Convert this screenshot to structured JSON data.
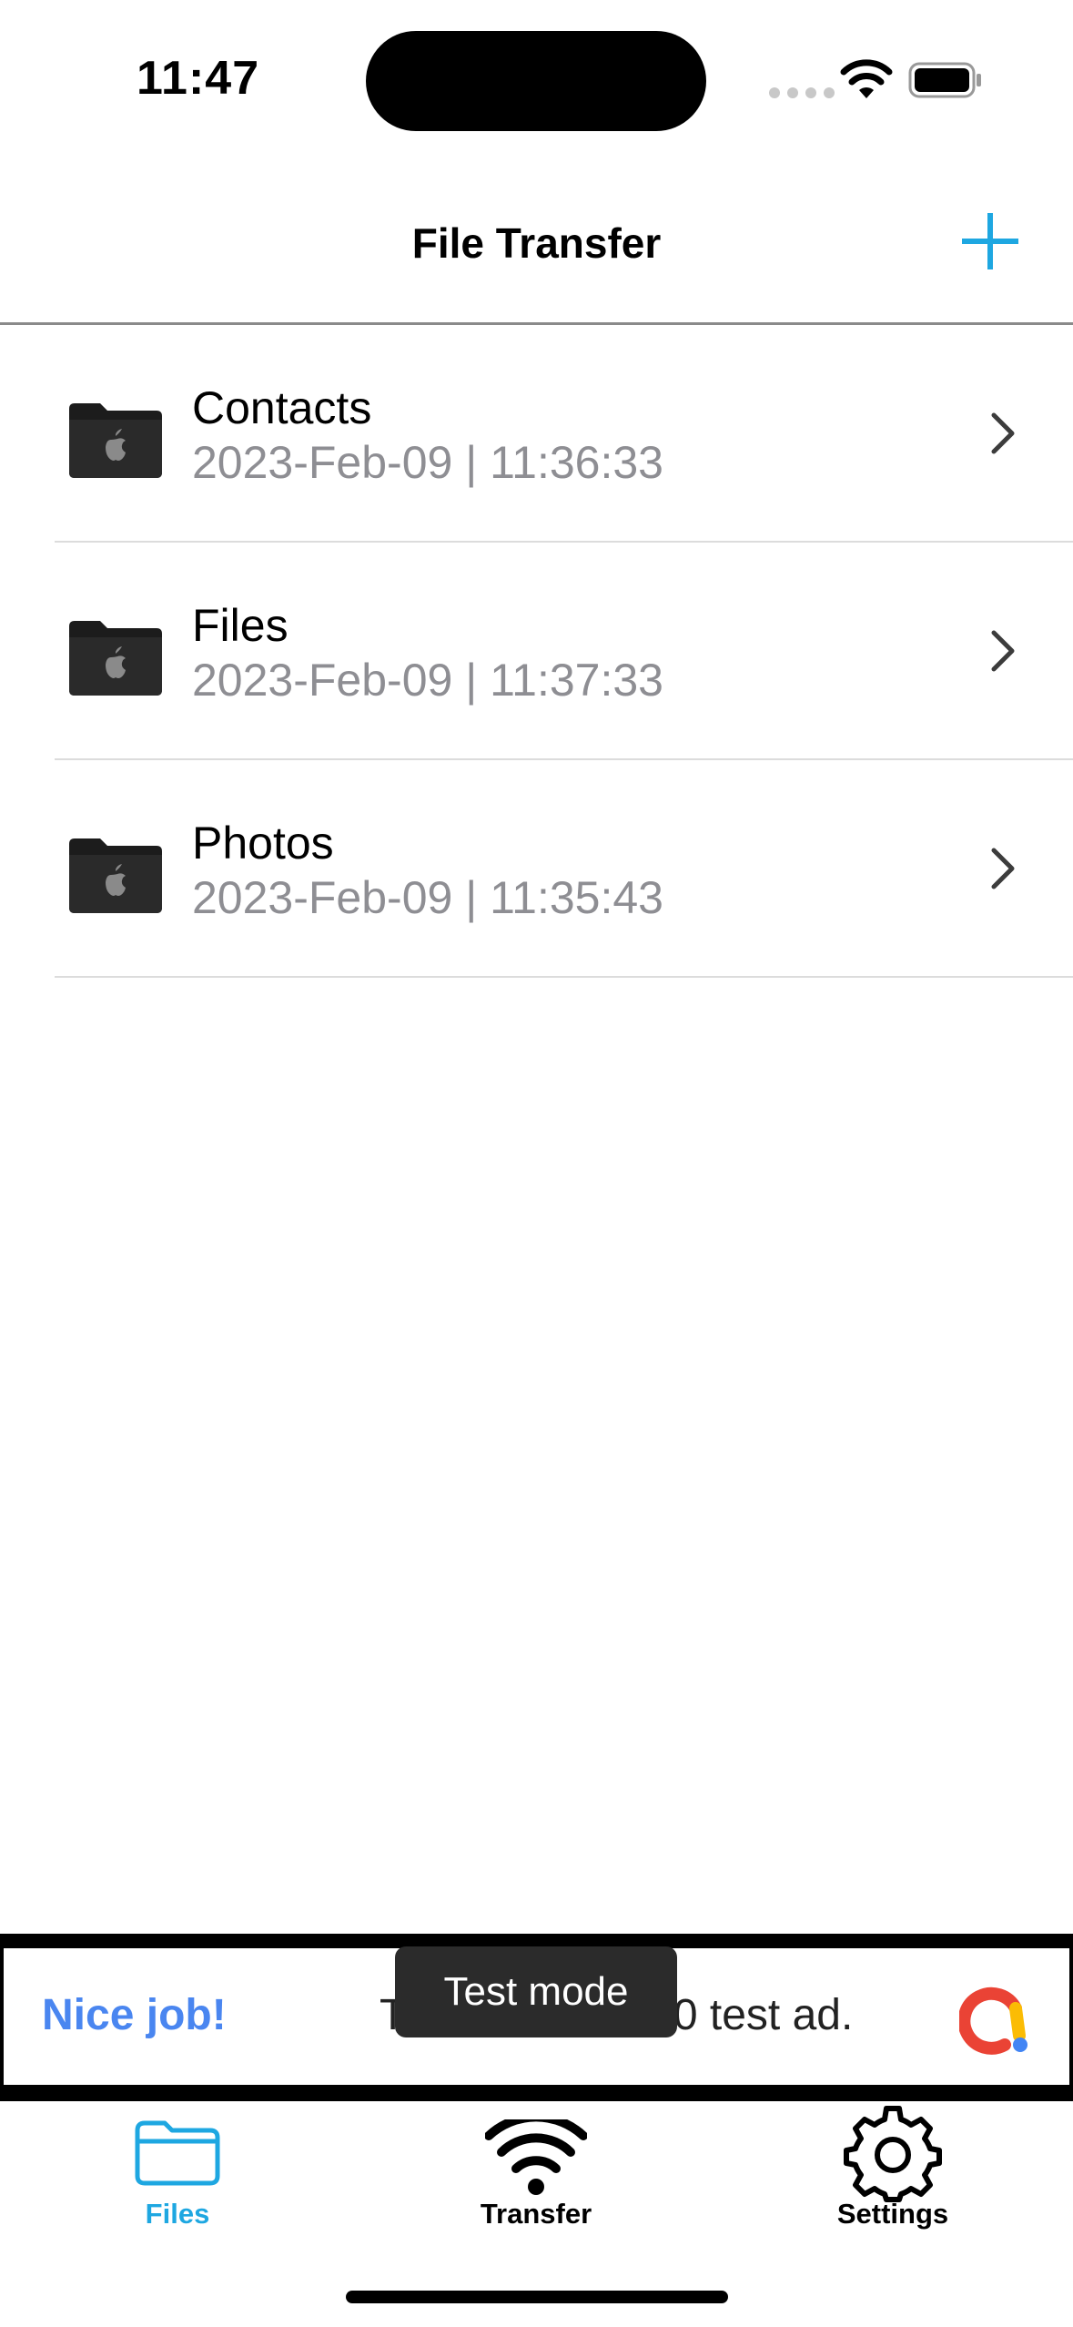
{
  "status_bar": {
    "time": "11:47"
  },
  "nav": {
    "title": "File Transfer"
  },
  "files": [
    {
      "name": "Contacts",
      "date": "2023-Feb-09 | 11:36:33"
    },
    {
      "name": "Files",
      "date": "2023-Feb-09 | 11:37:33"
    },
    {
      "name": "Photos",
      "date": "2023-Feb-09 | 11:35:43"
    }
  ],
  "ad": {
    "headline": "Nice job!",
    "body": "This is a 320x50 test ad.",
    "badge": "Test mode"
  },
  "tabs": [
    {
      "label": "Files",
      "icon": "folder-icon",
      "active": true
    },
    {
      "label": "Transfer",
      "icon": "wifi-icon",
      "active": false
    },
    {
      "label": "Settings",
      "icon": "gear-icon",
      "active": false
    }
  ],
  "colors": {
    "accent": "#1ea7e1",
    "ad_blue": "#4a86f0",
    "secondary_text": "#8e8e93"
  }
}
